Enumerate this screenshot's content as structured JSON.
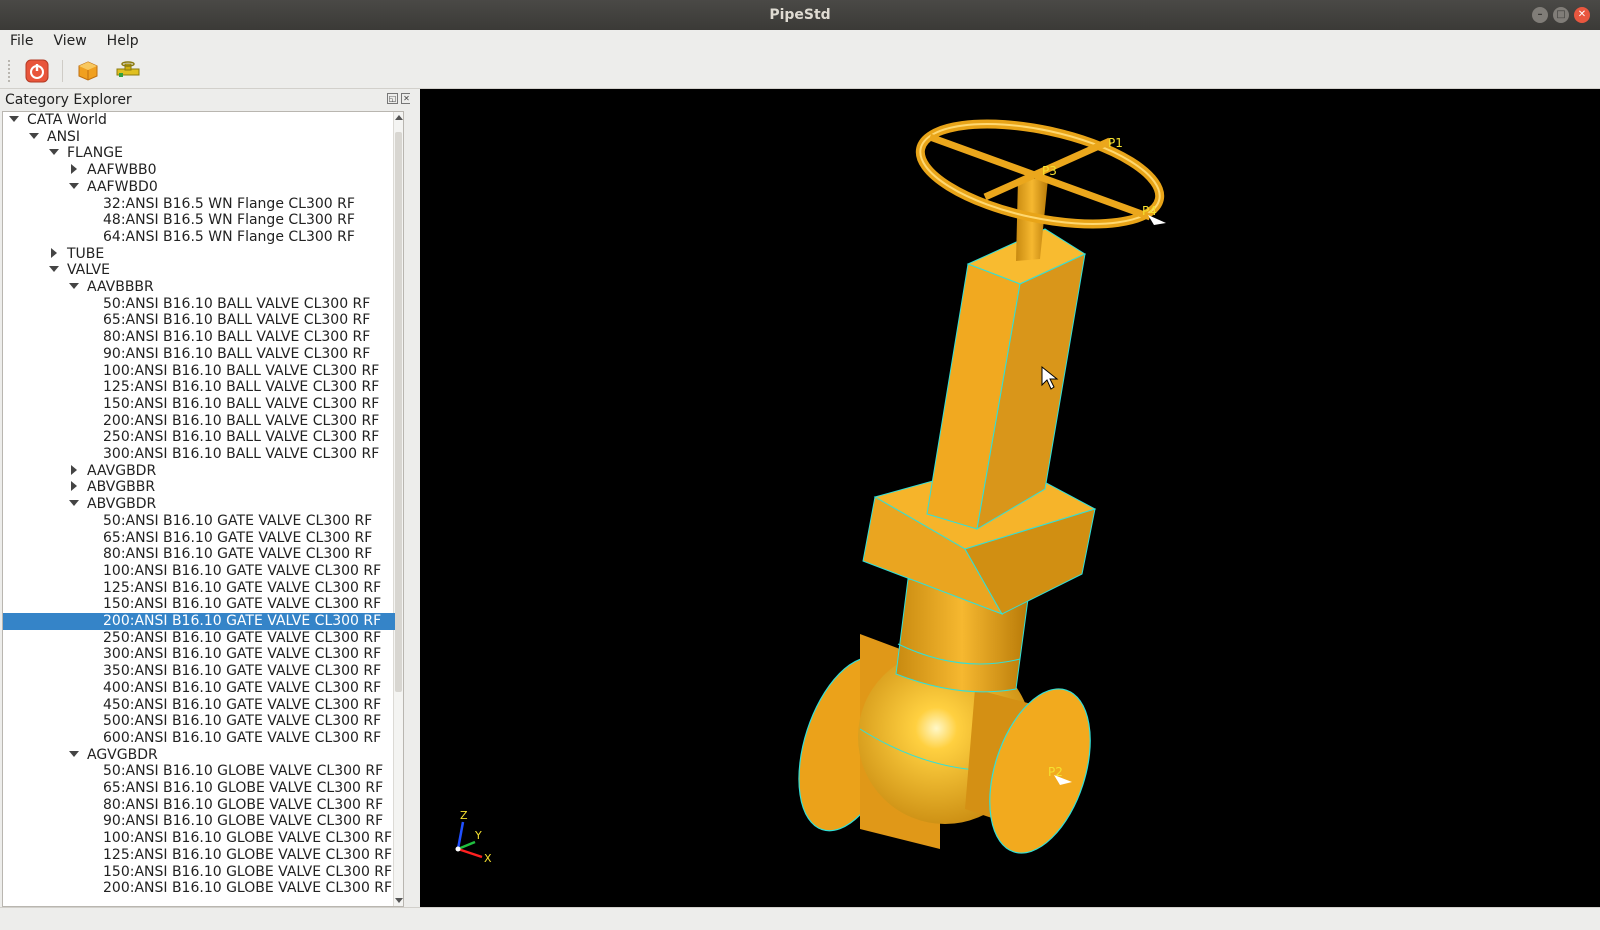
{
  "window": {
    "title": "PipeStd"
  },
  "menubar": [
    "File",
    "View",
    "Help"
  ],
  "toolbar": {
    "icons": [
      "power-icon",
      "cube-icon",
      "pipe-icon"
    ]
  },
  "panel": {
    "title": "Category Explorer"
  },
  "tree": [
    {
      "level": 0,
      "expand": "open",
      "label": "CATA World"
    },
    {
      "level": 1,
      "expand": "open",
      "label": "ANSI"
    },
    {
      "level": 2,
      "expand": "open",
      "label": "FLANGE"
    },
    {
      "level": 3,
      "expand": "closed",
      "label": "AAFWBB0"
    },
    {
      "level": 3,
      "expand": "open",
      "label": "AAFWBD0"
    },
    {
      "level": 4,
      "expand": "",
      "label": "32:ANSI B16.5 WN Flange CL300 RF"
    },
    {
      "level": 4,
      "expand": "",
      "label": "48:ANSI B16.5 WN Flange CL300 RF"
    },
    {
      "level": 4,
      "expand": "",
      "label": "64:ANSI B16.5 WN Flange CL300 RF"
    },
    {
      "level": 2,
      "expand": "closed",
      "label": "TUBE"
    },
    {
      "level": 2,
      "expand": "open",
      "label": "VALVE"
    },
    {
      "level": 3,
      "expand": "open",
      "label": "AAVBBBR"
    },
    {
      "level": 4,
      "expand": "",
      "label": "50:ANSI B16.10 BALL VALVE CL300 RF"
    },
    {
      "level": 4,
      "expand": "",
      "label": "65:ANSI B16.10 BALL VALVE CL300 RF"
    },
    {
      "level": 4,
      "expand": "",
      "label": "80:ANSI B16.10 BALL VALVE CL300 RF"
    },
    {
      "level": 4,
      "expand": "",
      "label": "90:ANSI B16.10 BALL VALVE CL300 RF"
    },
    {
      "level": 4,
      "expand": "",
      "label": "100:ANSI B16.10 BALL VALVE CL300 RF"
    },
    {
      "level": 4,
      "expand": "",
      "label": "125:ANSI B16.10 BALL VALVE CL300 RF"
    },
    {
      "level": 4,
      "expand": "",
      "label": "150:ANSI B16.10 BALL VALVE CL300 RF"
    },
    {
      "level": 4,
      "expand": "",
      "label": "200:ANSI B16.10 BALL VALVE CL300 RF"
    },
    {
      "level": 4,
      "expand": "",
      "label": "250:ANSI B16.10 BALL VALVE CL300 RF"
    },
    {
      "level": 4,
      "expand": "",
      "label": "300:ANSI B16.10 BALL VALVE CL300 RF"
    },
    {
      "level": 3,
      "expand": "closed",
      "label": "AAVGBDR"
    },
    {
      "level": 3,
      "expand": "closed",
      "label": "ABVGBBR"
    },
    {
      "level": 3,
      "expand": "open",
      "label": "ABVGBDR"
    },
    {
      "level": 4,
      "expand": "",
      "label": "50:ANSI B16.10 GATE VALVE CL300 RF"
    },
    {
      "level": 4,
      "expand": "",
      "label": "65:ANSI B16.10 GATE VALVE CL300 RF"
    },
    {
      "level": 4,
      "expand": "",
      "label": "80:ANSI B16.10 GATE VALVE CL300 RF"
    },
    {
      "level": 4,
      "expand": "",
      "label": "100:ANSI B16.10 GATE VALVE CL300 RF"
    },
    {
      "level": 4,
      "expand": "",
      "label": "125:ANSI B16.10 GATE VALVE CL300 RF"
    },
    {
      "level": 4,
      "expand": "",
      "label": "150:ANSI B16.10 GATE VALVE CL300 RF"
    },
    {
      "level": 4,
      "expand": "",
      "label": "200:ANSI B16.10 GATE VALVE CL300 RF",
      "selected": true
    },
    {
      "level": 4,
      "expand": "",
      "label": "250:ANSI B16.10 GATE VALVE CL300 RF"
    },
    {
      "level": 4,
      "expand": "",
      "label": "300:ANSI B16.10 GATE VALVE CL300 RF"
    },
    {
      "level": 4,
      "expand": "",
      "label": "350:ANSI B16.10 GATE VALVE CL300 RF"
    },
    {
      "level": 4,
      "expand": "",
      "label": "400:ANSI B16.10 GATE VALVE CL300 RF"
    },
    {
      "level": 4,
      "expand": "",
      "label": "450:ANSI B16.10 GATE VALVE CL300 RF"
    },
    {
      "level": 4,
      "expand": "",
      "label": "500:ANSI B16.10 GATE VALVE CL300 RF"
    },
    {
      "level": 4,
      "expand": "",
      "label": "600:ANSI B16.10 GATE VALVE CL300 RF"
    },
    {
      "level": 3,
      "expand": "open",
      "label": "AGVGBDR"
    },
    {
      "level": 4,
      "expand": "",
      "label": "50:ANSI B16.10 GLOBE VALVE CL300 RF"
    },
    {
      "level": 4,
      "expand": "",
      "label": "65:ANSI B16.10 GLOBE VALVE CL300 RF"
    },
    {
      "level": 4,
      "expand": "",
      "label": "80:ANSI B16.10 GLOBE VALVE CL300 RF"
    },
    {
      "level": 4,
      "expand": "",
      "label": "90:ANSI B16.10 GLOBE VALVE CL300 RF"
    },
    {
      "level": 4,
      "expand": "",
      "label": "100:ANSI B16.10 GLOBE VALVE CL300 RF"
    },
    {
      "level": 4,
      "expand": "",
      "label": "125:ANSI B16.10 GLOBE VALVE CL300 RF"
    },
    {
      "level": 4,
      "expand": "",
      "label": "150:ANSI B16.10 GLOBE VALVE CL300 RF"
    },
    {
      "level": 4,
      "expand": "",
      "label": "200:ANSI B16.10 GLOBE VALVE CL300 RF"
    }
  ],
  "viewport": {
    "port_labels": [
      "P1",
      "P3",
      "P4",
      "P2"
    ],
    "axes": {
      "z": "Z",
      "y": "Y",
      "x": "X"
    },
    "colors": {
      "body": "#f0ad1e",
      "edges": "#32e0d8",
      "background": "#000000"
    }
  }
}
